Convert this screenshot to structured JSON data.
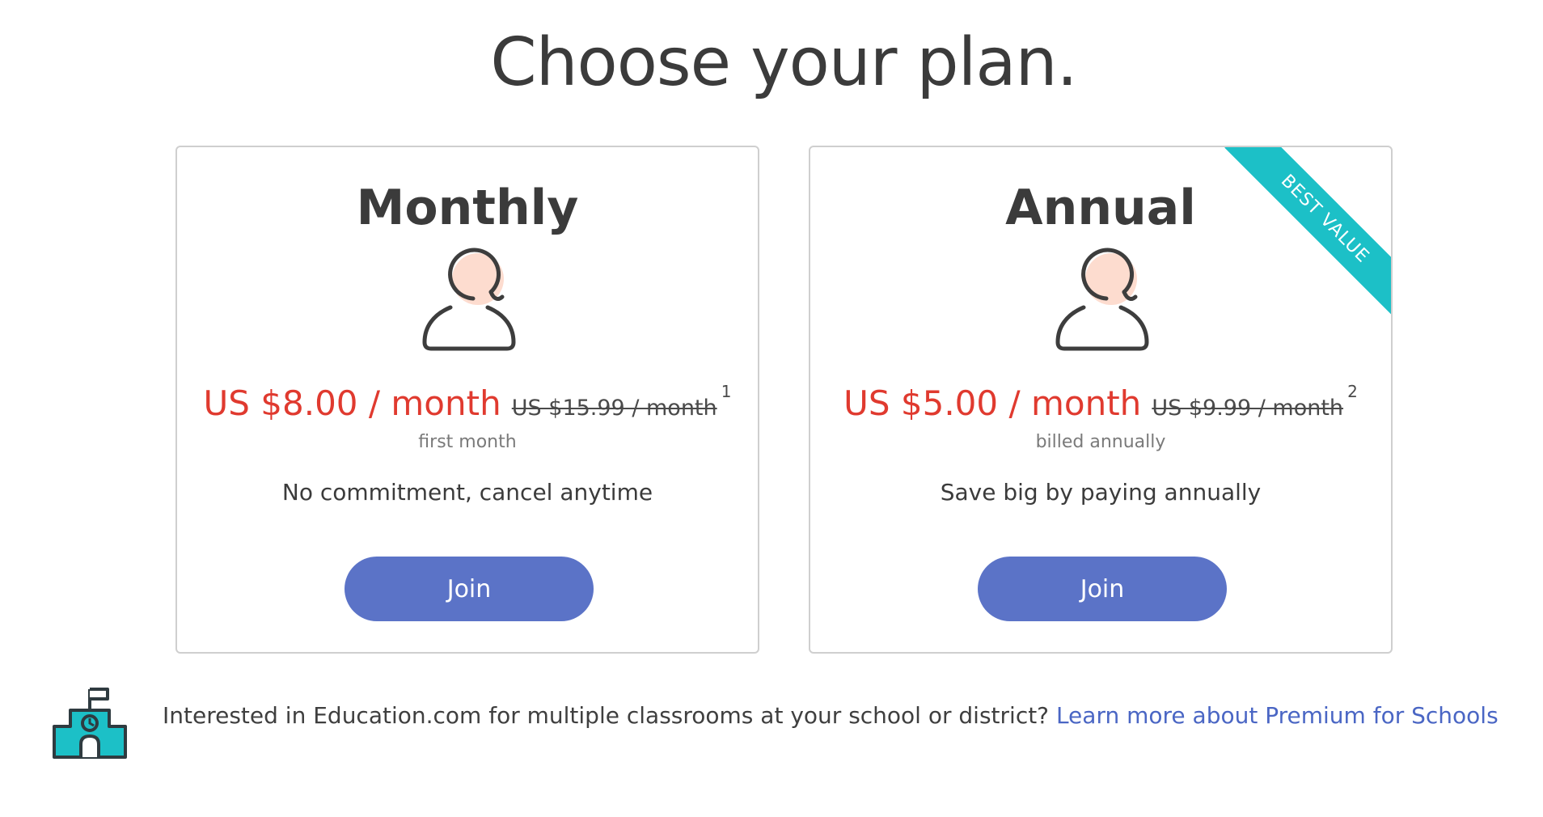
{
  "page": {
    "title": "Choose your plan."
  },
  "plans": [
    {
      "name": "Monthly",
      "price": "US $8.00 / month",
      "old_price": "US $15.99 / month",
      "footnote": "1",
      "note": "first month",
      "description": "No commitment, cancel anytime",
      "button_label": "Join"
    },
    {
      "name": "Annual",
      "price": "US $5.00 / month",
      "old_price": "US $9.99 / month",
      "footnote": "2",
      "note": "billed annually",
      "description": "Save big by paying annually",
      "button_label": "Join",
      "badge": "BEST VALUE"
    }
  ],
  "schools": {
    "text": "Interested in Education.com for multiple classrooms at your school or district?",
    "link_text": "Learn more about Premium for Schools"
  },
  "icons": {
    "plan": "user-icon",
    "schools": "school-icon"
  },
  "colors": {
    "price": "#e03a2f",
    "button": "#5b73c7",
    "ribbon": "#1cc0c7",
    "link": "#4a66c4",
    "avatar_accent": "#fddccf"
  }
}
